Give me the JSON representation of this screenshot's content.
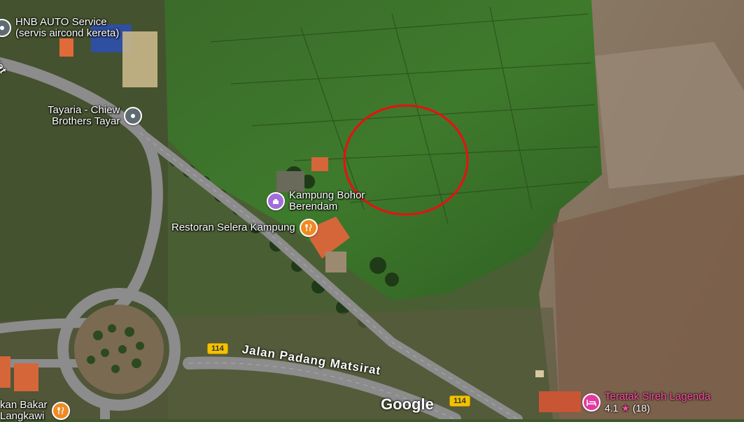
{
  "pois": [
    {
      "id": "hnb",
      "line1": "HNB AUTO Service",
      "line2": "(servis aircond kereta)",
      "icon": "car-service-icon",
      "color": "#5f6b73"
    },
    {
      "id": "tayaria",
      "line1": "Tayaria - Chiew",
      "line2": "Brothers Tayar",
      "icon": "tyre-shop-icon",
      "color": "#5f6b73"
    },
    {
      "id": "kampung",
      "line1": "Kampung Bohor",
      "line2": "Berendam",
      "icon": "landmark-icon",
      "color": "#a36ddb"
    },
    {
      "id": "restoran",
      "line1": "Restoran Selera Kampung",
      "line2": "",
      "icon": "restaurant-icon",
      "color": "#f08a24"
    },
    {
      "id": "ikan",
      "line1": "kan Bakar",
      "line2": "Langkawi",
      "icon": "restaurant-icon",
      "color": "#f08a24"
    },
    {
      "id": "teratak",
      "line1": "Teratak Sireh Lagenda",
      "line2": "",
      "rating": "4.1",
      "stars": "★",
      "reviews": "(18)",
      "icon": "lodging-icon",
      "color": "#e33aa0"
    }
  ],
  "roads": {
    "main_name": "Jalan Padang Matsirat",
    "shield_1": "114",
    "shield_2": "114",
    "edge_fragment": "rat"
  },
  "branding": "Google",
  "highlight": {
    "color": "#e81010"
  }
}
